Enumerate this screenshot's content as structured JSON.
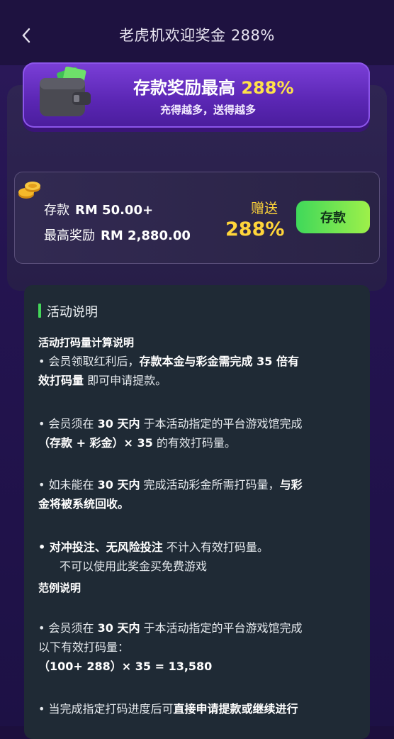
{
  "header": {
    "title": "老虎机欢迎奖金 288%"
  },
  "banner": {
    "title_prefix": "存款奖励最高",
    "title_highlight": "288%",
    "subtitle": "充得越多，送得越多"
  },
  "offer": {
    "deposit_label": "存款",
    "deposit_value": "RM 50.00+",
    "max_label": "最高奖励",
    "max_value": "RM 2,880.00",
    "gift_label": "赠送",
    "gift_percent": "288%",
    "button_label": "存款"
  },
  "rules": {
    "heading": "活动说明",
    "calc_title": "活动打码量计算说明",
    "p1_a": "• 会员领取红利后，",
    "p1_b": "存款本金与彩金需完成 35 倍有",
    "p1_c": "效打码量",
    "p1_d": " 即可申请提款。",
    "p2_a": "• 会员须在 ",
    "p2_b": "30 天内",
    "p2_c": " 于本活动指定的平台游戏馆完成",
    "p2_d": "（存款 + 彩金）× 35",
    "p2_e": " 的有效打码量。",
    "p3_a": "• 如未能在 ",
    "p3_b": "30 天内",
    "p3_c": " 完成活动彩金所需打码量，",
    "p3_d": "与彩",
    "p3_e": "金将被系统回收。",
    "p4_a": "• 对冲投注、无风险投注",
    "p4_b": " 不计入有效打码量。",
    "p4_c": "不可以使用此奖金买免费游戏",
    "example_title": "范例说明",
    "p5_a": "• 会员须在 ",
    "p5_b": "30 天内",
    "p5_c": " 于本活动指定的平台游戏馆完成",
    "p5_d": "以下有效打码量：",
    "p5_e": "（100+ 288）× 35 = 13,580",
    "p6_a": "• 当完成指定打码进度后可",
    "p6_b": "直接申请提款或继续进行"
  },
  "colors": {
    "accent_yellow": "#ffd53a",
    "accent_green": "#43d659",
    "banner_purple": "#6a30c8"
  }
}
